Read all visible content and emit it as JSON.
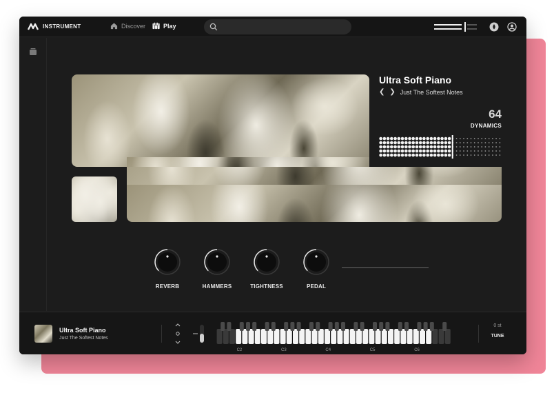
{
  "app": {
    "brand": "INSTRUMENT"
  },
  "nav": {
    "items": [
      {
        "label": "Discover",
        "icon": "home-icon"
      },
      {
        "label": "Play",
        "icon": "piano-keys-icon"
      }
    ]
  },
  "search": {
    "placeholder": ""
  },
  "preset": {
    "title": "Ultra Soft Piano",
    "subtitle": "Just The Softest Notes"
  },
  "dynamics": {
    "value": "64",
    "label": "DYNAMICS",
    "level": 0.64
  },
  "knobs": [
    {
      "label": "REVERB"
    },
    {
      "label": "HAMMERS"
    },
    {
      "label": "TIGHTNESS"
    },
    {
      "label": "PEDAL"
    }
  ],
  "player": {
    "title": "Ultra Soft Piano",
    "subtitle": "Just The Softest Notes"
  },
  "keyboard": {
    "octave_labels": [
      "C2",
      "C3",
      "C4",
      "C5",
      "C6"
    ]
  },
  "tune": {
    "value": "0 st",
    "label": "TUNE"
  },
  "colors": {
    "accent_pink": "#f08598",
    "app_bg": "#1c1c1c",
    "text": "#ffffff"
  }
}
